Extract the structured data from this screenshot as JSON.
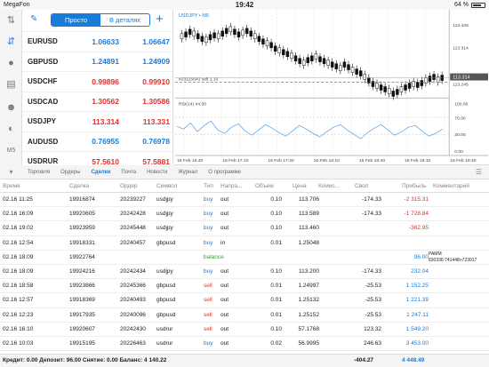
{
  "status_bar": {
    "carrier": "MegaFon",
    "time": "19:42",
    "battery": "64 %"
  },
  "quotes": {
    "mode_simple": "Просто",
    "mode_detailed": "В деталях",
    "rows": [
      {
        "symbol": "EURUSD",
        "bid": "1.06633",
        "ask": "1.06647",
        "dir": "blue"
      },
      {
        "symbol": "GBPUSD",
        "bid": "1.24891",
        "ask": "1.24909",
        "dir": "blue"
      },
      {
        "symbol": "USDCHF",
        "bid": "0.99896",
        "ask": "0.99910",
        "dir": "red"
      },
      {
        "symbol": "USDCAD",
        "bid": "1.30562",
        "ask": "1.30586",
        "dir": "red"
      },
      {
        "symbol": "USDJPY",
        "bid": "113.314",
        "ask": "113.331",
        "dir": "red"
      },
      {
        "symbol": "AUDUSD",
        "bid": "0.76955",
        "ask": "0.76978",
        "dir": "blue"
      },
      {
        "symbol": "USDRUR",
        "bid": "57.5610",
        "ask": "57.5881",
        "dir": "red"
      }
    ]
  },
  "chart": {
    "title": "USDJPY • M5",
    "order_line_label": "#23115643 sell 1.10",
    "rsi_label": "RSI(14) 44.30",
    "price_labels": [
      "113.425",
      "113.314",
      "113.245"
    ],
    "current_price": "113.314",
    "rsi_levels": [
      "100.00",
      "70.00",
      "30.00",
      "0.00"
    ],
    "time_labels": [
      "16 Feb 16:40",
      "16 Feb 17:10",
      "16 Feb 17:40",
      "16 Feb 18:10",
      "16 Feb 18:40",
      "16 Feb 19:10",
      "16 Feb 19:40"
    ]
  },
  "tabs": [
    "Торговля",
    "Ордеры",
    "Сделки",
    "Почта",
    "Новости",
    "Журнал",
    "О программе"
  ],
  "active_tab": "Сделки",
  "table": {
    "headers": [
      "Время",
      "Сделка",
      "Ордер",
      "Символ",
      "Тип",
      "Напра...",
      "Объем",
      "Цена",
      "Комис...",
      "Своп",
      "Прибыль",
      "Комментарий"
    ],
    "rows": [
      {
        "time": "02.16 11:25",
        "deal": "19916874",
        "order": "20239227",
        "symbol": "usdjpy",
        "type": "buy",
        "dir": "out",
        "vol": "0.10",
        "price": "113.706",
        "comm": "",
        "swap": "-174.33",
        "profit": "-2 315.31",
        "comment": ""
      },
      {
        "time": "02.16 16:09",
        "deal": "19920605",
        "order": "20242428",
        "symbol": "usdjpy",
        "type": "buy",
        "dir": "out",
        "vol": "0.10",
        "price": "113.589",
        "comm": "",
        "swap": "-174.33",
        "profit": "-1 728.84",
        "comment": ""
      },
      {
        "time": "02.16 19:02",
        "deal": "19923959",
        "order": "20245448",
        "symbol": "usdjpy",
        "type": "buy",
        "dir": "out",
        "vol": "0.10",
        "price": "113.460",
        "comm": "",
        "swap": "",
        "profit": "-362.95",
        "comment": ""
      },
      {
        "time": "02.16 12:54",
        "deal": "19918331",
        "order": "20240457",
        "symbol": "gbpusd",
        "type": "buy",
        "dir": "in",
        "vol": "0.01",
        "price": "1.25048",
        "comm": "",
        "swap": "",
        "profit": "",
        "comment": ""
      },
      {
        "time": "02.16 18:09",
        "deal": "19922764",
        "order": "",
        "symbol": "",
        "type": "balance",
        "dir": "",
        "vol": "",
        "price": "",
        "comm": "",
        "swap": "",
        "profit": "96.00",
        "comment": "PAMM 830336:741448>723017"
      },
      {
        "time": "02.16 18:09",
        "deal": "19924216",
        "order": "20242434",
        "symbol": "usdjpy",
        "type": "buy",
        "dir": "out",
        "vol": "0.10",
        "price": "113.200",
        "comm": "",
        "swap": "-174.33",
        "profit": "232.04",
        "comment": ""
      },
      {
        "time": "02.16 18:58",
        "deal": "19923866",
        "order": "20245366",
        "symbol": "gbpusd",
        "type": "sell",
        "dir": "out",
        "vol": "0.01",
        "price": "1.24997",
        "comm": "",
        "swap": "-25.53",
        "profit": "1 152.25",
        "comment": ""
      },
      {
        "time": "02.16 12:57",
        "deal": "19918369",
        "order": "20240493",
        "symbol": "gbpusd",
        "type": "sell",
        "dir": "out",
        "vol": "0.01",
        "price": "1.25132",
        "comm": "",
        "swap": "-25.53",
        "profit": "1 221.39",
        "comment": ""
      },
      {
        "time": "02.16 12:23",
        "deal": "19917935",
        "order": "20240096",
        "symbol": "gbpusd",
        "type": "sell",
        "dir": "out",
        "vol": "0.01",
        "price": "1.25152",
        "comm": "",
        "swap": "-25.53",
        "profit": "1 247.11",
        "comment": ""
      },
      {
        "time": "02.16 16:10",
        "deal": "19920607",
        "order": "20242430",
        "symbol": "usdrur",
        "type": "sell",
        "dir": "out",
        "vol": "0.10",
        "price": "57.1768",
        "comm": "",
        "swap": "123.32",
        "profit": "1 549.20",
        "comment": ""
      },
      {
        "time": "02.16 10:03",
        "deal": "19915195",
        "order": "20226463",
        "symbol": "usdrur",
        "type": "buy",
        "dir": "out",
        "vol": "0.02",
        "price": "56.9995",
        "comm": "",
        "swap": "246.63",
        "profit": "3 453.00",
        "comment": ""
      }
    ]
  },
  "footer": {
    "summary": "Кредит: 0.00 Депозит: 96.00 Снятие: 0.00 Баланс: 4 140.22",
    "swap_total": "-404.27",
    "profit_total": "4 448.49"
  }
}
